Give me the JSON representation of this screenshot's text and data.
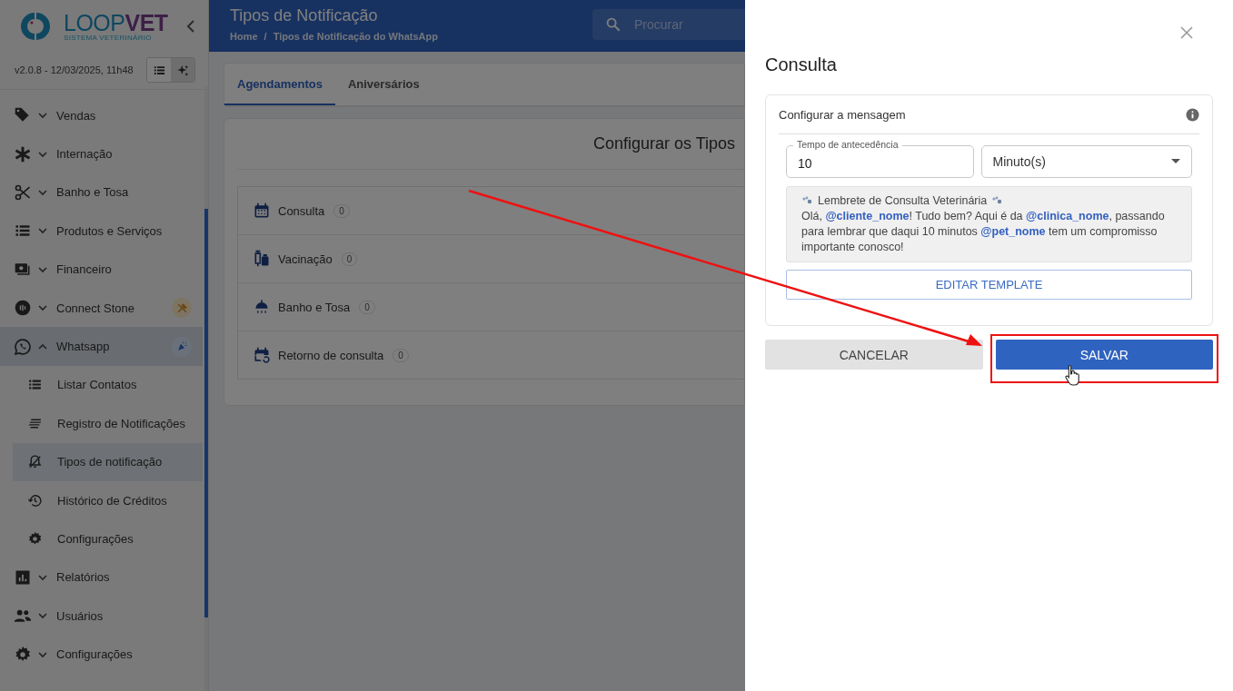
{
  "sidebar": {
    "logo": {
      "wordmark": [
        "LOOP",
        "VET"
      ],
      "tagline": "SISTEMA VETERINÁRIO"
    },
    "version": "v2.0.8 - 12/03/2025, 11h48",
    "view_toggles": [
      {
        "selected": false
      },
      {
        "selected": true
      }
    ],
    "items": [
      {
        "label": "Vendas",
        "expanded": false,
        "selected": false
      },
      {
        "label": "Internação",
        "expanded": false,
        "selected": false
      },
      {
        "label": "Banho e Tosa",
        "expanded": false,
        "selected": false
      },
      {
        "label": "Produtos e Serviços",
        "expanded": false,
        "selected": false
      },
      {
        "label": "Financeiro",
        "expanded": false,
        "selected": false
      },
      {
        "label": "Connect Stone",
        "expanded": false,
        "selected": false
      },
      {
        "label": "Whatsapp",
        "expanded": true,
        "selected": true,
        "children": [
          {
            "label": "Listar Contatos",
            "selected": false
          },
          {
            "label": "Registro de Notificações",
            "selected": false
          },
          {
            "label": "Tipos de notificação",
            "selected": true
          },
          {
            "label": "Histórico de Créditos",
            "selected": false
          },
          {
            "label": "Configurações",
            "selected": false
          }
        ]
      },
      {
        "label": "Relatórios",
        "expanded": false,
        "selected": false
      },
      {
        "label": "Usuários",
        "expanded": false,
        "selected": false
      },
      {
        "label": "Configurações",
        "expanded": false,
        "selected": false
      }
    ]
  },
  "header": {
    "title": "Tipos de Notificação",
    "breadcrumb": [
      "Home",
      "/",
      "Tipos de Notificação do WhatsApp"
    ],
    "search": {
      "placeholder": "Procurar"
    }
  },
  "tabs": [
    {
      "label": "Agendamentos",
      "selected": true
    },
    {
      "label": "Aniversários",
      "selected": false
    }
  ],
  "panel": {
    "heading": "Configurar os Tipos",
    "types": [
      {
        "label": "Consulta",
        "count": "0"
      },
      {
        "label": "Vacinação",
        "count": "0"
      },
      {
        "label": "Banho e Tosa",
        "count": "0"
      },
      {
        "label": "Retorno de consulta",
        "count": "0"
      }
    ]
  },
  "drawer": {
    "title": "Consulta",
    "card_title": "Configurar a mensagem",
    "lead_time": {
      "label": "Tempo de antecedência",
      "value": "10"
    },
    "unit": {
      "value": "Minuto(s)"
    },
    "message": [
      "Lembrete de Consulta Veterinária",
      "Olá, **@cliente_nome**! Tudo bem? Aqui é da **@clinica_nome**, passando para lembrar que daqui 10 minutos **@pet_nome** tem um compromisso importante conosco!"
    ],
    "edit_button": "EDITAR TEMPLATE",
    "buttons": [
      {
        "kind": "secondary",
        "label": "CANCELAR"
      },
      {
        "kind": "primary",
        "label": "SALVAR"
      }
    ]
  },
  "annotations": [
    {
      "kind": "arrow"
    },
    {
      "kind": "highlight"
    },
    {
      "kind": "cursor"
    }
  ]
}
